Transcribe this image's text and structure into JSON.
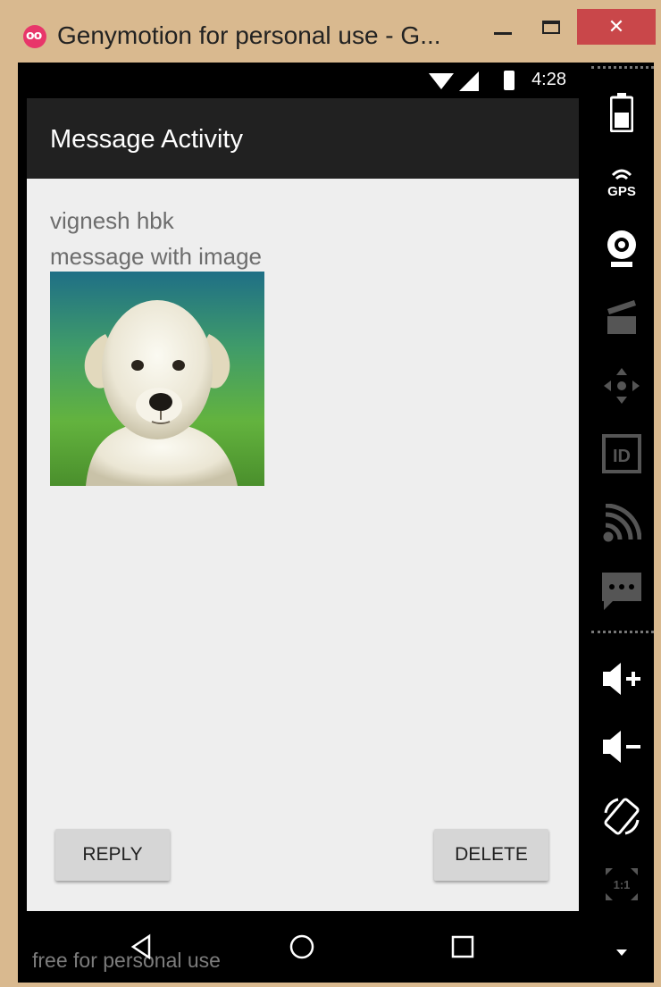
{
  "window": {
    "title": "Genymotion for personal use - G...",
    "logo_text": "oo",
    "close_glyph": "✕"
  },
  "status_bar": {
    "time": "4:28"
  },
  "app_bar": {
    "title": "Message Activity"
  },
  "message": {
    "sender": "vignesh hbk",
    "body": "message with image",
    "image_icon": "puppy-photo"
  },
  "actions": {
    "reply_label": "REPLY",
    "delete_label": "DELETE"
  },
  "watermark": "free for personal use",
  "sidebar": {
    "items": [
      "battery-icon",
      "gps-icon",
      "webcam-icon",
      "capture-icon",
      "dpad-icon",
      "device-id-icon",
      "network-icon",
      "sms-icon",
      "volume-up-icon",
      "volume-down-icon",
      "rotate-icon",
      "scale-icon"
    ],
    "gps_label": "GPS",
    "id_label": "ID",
    "scale_label": "1:1"
  },
  "colors": {
    "app_bar": "#212121",
    "content_bg": "#eeeeee",
    "button": "#d6d6d6",
    "close_button": "#c9474a",
    "frame": "#d9b98f"
  }
}
